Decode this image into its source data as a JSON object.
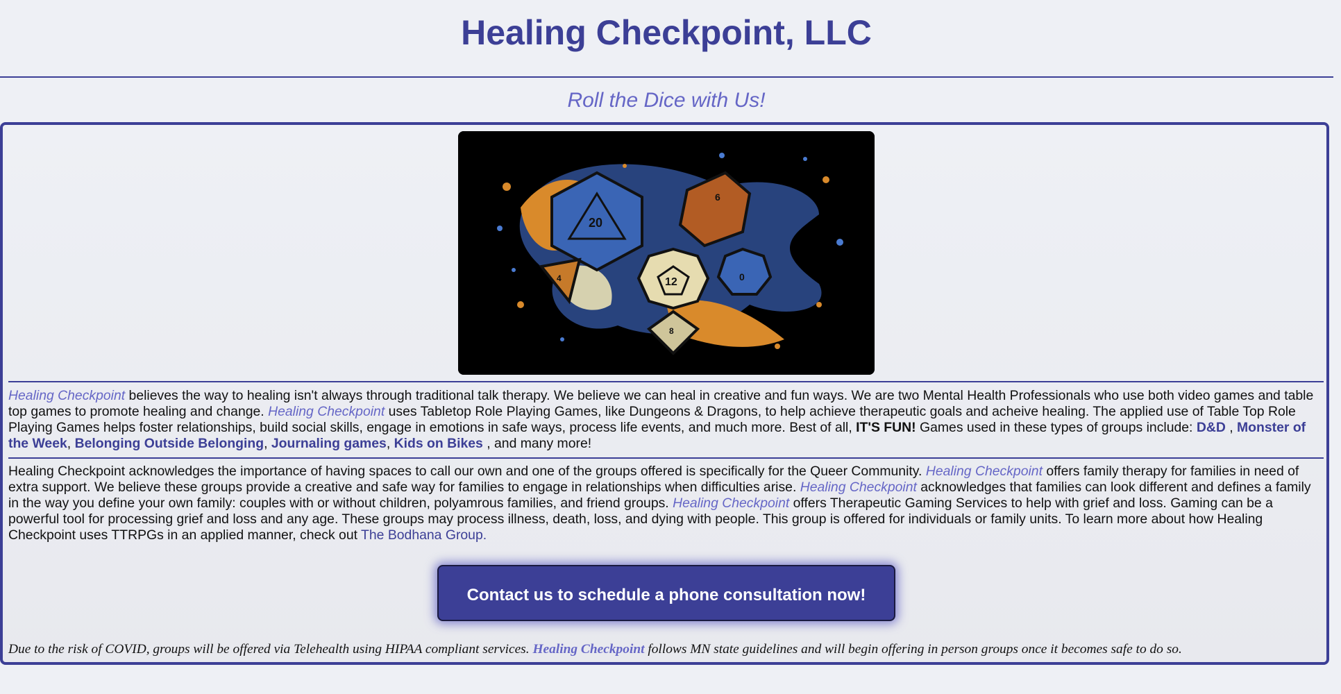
{
  "header": {
    "title": "Healing Checkpoint, LLC",
    "tagline": "Roll the Dice with Us!"
  },
  "hero": {
    "icon": "dice-illustration",
    "die_labels": [
      "20",
      "6",
      "4",
      "12",
      "0",
      "8"
    ]
  },
  "intro": {
    "brand": "Healing Checkpoint",
    "text1": " believes the way to healing isn't always through traditional talk therapy. We believe we can heal in creative and fun ways. We are two Mental Health Professionals who use both video games and table top games to promote healing and change. ",
    "brand2": "Healing Checkpoint",
    "text2": " uses Tabletop Role Playing Games, like Dungeons & Dragons, to help achieve therapeutic goals and acheive healing. The applied use of Table Top Role Playing Games helps foster relationships, build social skills, engage in emotions in safe ways, process life events, and much more. Best of all, ",
    "fun": "IT'S FUN!",
    "text3": " Games used in these types of groups include: ",
    "games": [
      "D&D",
      "Monster of the Week",
      "Belonging Outside Belonging",
      "Journaling games",
      "Kids on Bikes"
    ],
    "sep_space_comma": " , ",
    "sep_comma": ", ",
    "text4": " , and many more!"
  },
  "services": {
    "text1": "Healing Checkpoint acknowledges the importance of having spaces to call our own and one of the groups offered is specifically for the Queer Community. ",
    "brand1": "Healing Checkpoint",
    "text2": " offers family therapy for families in need of extra support. We believe these groups provide a creative and safe way for families to engage in relationships when difficulties arise. ",
    "brand2": "Healing Checkpoint",
    "text3": " acknowledges that families can look different and defines a family in the way you define your own family: couples with or without children, polyamrous families, and friend groups. ",
    "brand3": "Healing Checkpoint",
    "text4": " offers Therapeutic Gaming Services to help with grief and loss. Gaming can be a powerful tool for processing grief and loss and any age. These groups may process illness, death, loss, and dying with people. This group is offered for individuals or family units. To learn more about how Healing Checkpoint uses TTRPGs in an applied manner, check out ",
    "link": "The Bodhana Group."
  },
  "cta": {
    "label": "Contact us to schedule a phone consultation now!"
  },
  "notice": {
    "text1": "Due to the risk of COVID, groups will be offered via Telehealth using HIPAA compliant services. ",
    "brand": "Healing Checkpoint",
    "text2": " follows MN state guidelines and will begin offering in person groups once it becomes safe to do so."
  },
  "colors": {
    "primary": "#3c3f96",
    "accent": "#6566c6",
    "background": "#eef0f5"
  }
}
